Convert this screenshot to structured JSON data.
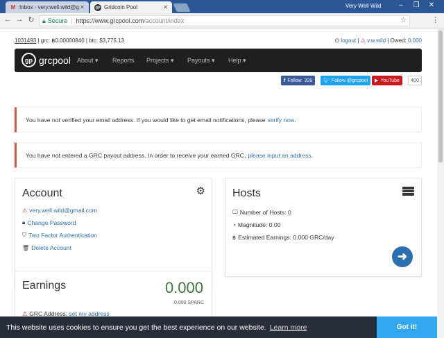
{
  "browser": {
    "tabs": [
      {
        "icon": "M",
        "title": "Inbox - very.well.wild@g..."
      },
      {
        "icon": "gp",
        "title": "Gridcoin Pool"
      }
    ],
    "window_user": "Very Well Wild",
    "secure_label": "Secure",
    "url_base": "https://www.grcpool.com",
    "url_path": "/account/index"
  },
  "status": {
    "block": "1031493",
    "grc_label": "grc:",
    "grc_value": "0.00000840",
    "btc_label": "btc:",
    "btc_value": "$3,775.13",
    "logout": "logout",
    "username": "v.w.wild",
    "owed_label": "Owed:",
    "owed_value": "0.000"
  },
  "navbar": {
    "brand": "grcpool",
    "logo": "gp",
    "items": [
      "About ▾",
      "Reports",
      "Projects ▾",
      "Payouts ▾",
      "Help ▾"
    ]
  },
  "social": {
    "fb_label": "Follow",
    "fb_count": "328",
    "tw_label": "Follow @grcpool",
    "yt_label": "YouTube",
    "yt_count": "400"
  },
  "alerts": [
    {
      "text": "You have not verified your email address. If you would like to get email notifications, please",
      "link": "verify now",
      "after": "."
    },
    {
      "text": "You have not entered a GRC payout address. In order to receive your earned GRC,",
      "link": "please input an address",
      "after": "."
    }
  ],
  "account": {
    "title": "Account",
    "email": "very.well.wild@gmail.com",
    "change_password": "Change Password",
    "two_factor": "Two Factor Authentication",
    "delete": "Delete Account"
  },
  "hosts": {
    "title": "Hosts",
    "num_hosts": "Number of Hosts: 0",
    "magnitude": "Magnitude: 0.00",
    "earnings": "Estimated Earnings: 0.000 GRC/day"
  },
  "earnings": {
    "title": "Earnings",
    "value": "0.000",
    "sparc": "0.000 SPARC",
    "grc_address_label": "GRC Address:",
    "grc_address_link": "set my address"
  },
  "cookie": {
    "text": "This website uses cookies to ensure you get the best experience on our website.",
    "learn_more": "Learn more",
    "button": "Got it!"
  }
}
